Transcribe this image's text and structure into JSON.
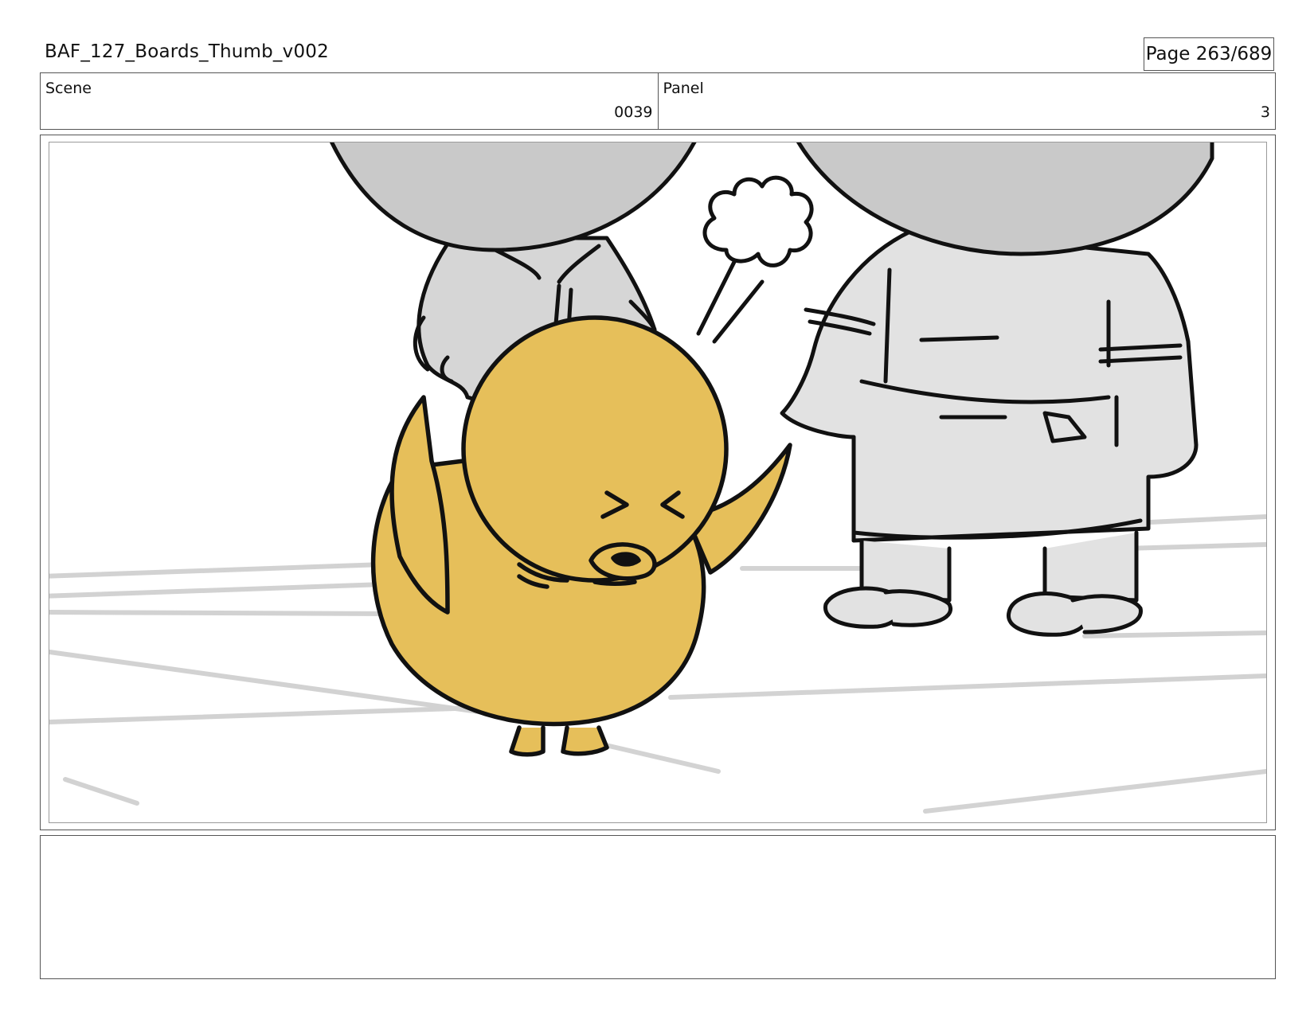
{
  "header": {
    "title": "BAF_127_Boards_Thumb_v002",
    "page_label": "Page 263/689"
  },
  "scene": {
    "label": "Scene",
    "value": "0039"
  },
  "panel": {
    "label": "Panel",
    "value": "3"
  },
  "artwork": {
    "characters": [
      "yellow-duck",
      "grey-figure-left",
      "grey-figure-right"
    ],
    "colors": {
      "duck_fill": "#E6BF5A",
      "figure_fill": "#E2E2E2",
      "head_fill": "#C9C9C9",
      "ink": "#111111"
    }
  },
  "notes": {
    "text": ""
  }
}
